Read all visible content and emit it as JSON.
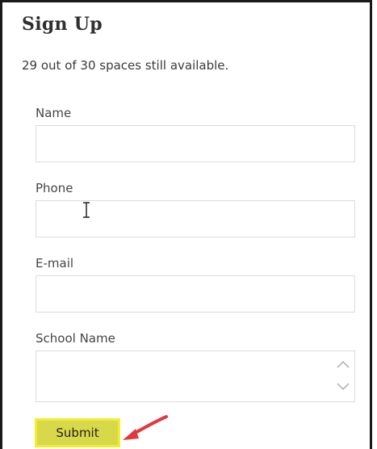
{
  "form": {
    "title": "Sign Up",
    "availability": "29 out of 30 spaces still available.",
    "fields": [
      {
        "label": "Name",
        "value": ""
      },
      {
        "label": "Phone",
        "value": ""
      },
      {
        "label": "E-mail",
        "value": ""
      },
      {
        "label": "School Name",
        "value": ""
      }
    ],
    "submit_label": "Submit"
  },
  "icons": {
    "cursor": "text-cursor-icon",
    "scroll_up": "chevron-up-icon",
    "scroll_down": "chevron-down-icon",
    "pointer": "red-arrow-icon"
  },
  "colors": {
    "submit_fill": "#d8d94a",
    "submit_highlight": "#f0ee30",
    "annotation_arrow": "#e0383e"
  }
}
